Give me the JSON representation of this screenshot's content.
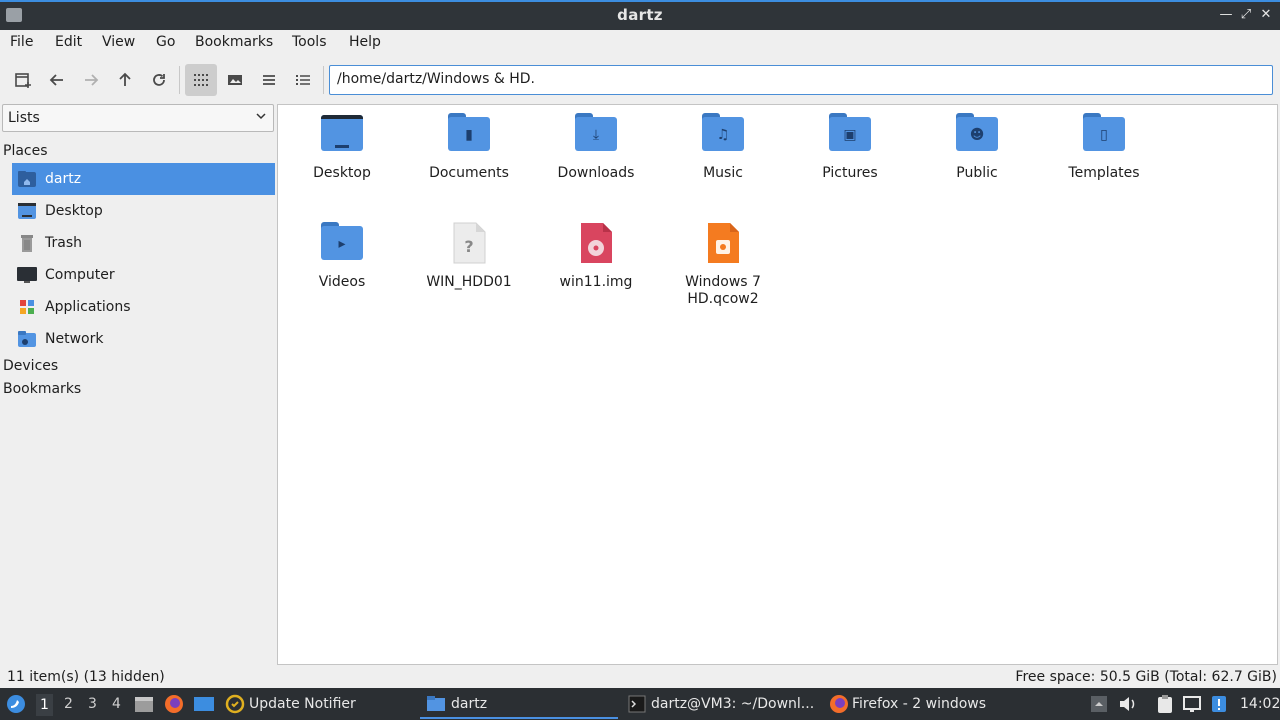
{
  "window": {
    "title": "dartz"
  },
  "menu": [
    "File",
    "Edit",
    "View",
    "Go",
    "Bookmarks",
    "Tools",
    "Help"
  ],
  "path": "/home/dartz/Windows & HD.",
  "side": {
    "select": "Lists",
    "places_heading": "Places",
    "items": [
      {
        "label": "dartz",
        "icon": "home-folder-icon"
      },
      {
        "label": "Desktop",
        "icon": "desktop-icon"
      },
      {
        "label": "Trash",
        "icon": "trash-icon"
      },
      {
        "label": "Computer",
        "icon": "computer-icon"
      },
      {
        "label": "Applications",
        "icon": "applications-icon"
      },
      {
        "label": "Network",
        "icon": "network-icon"
      }
    ],
    "devices_heading": "Devices",
    "bookmarks_heading": "Bookmarks"
  },
  "files": [
    {
      "name": "Desktop",
      "icon": "desktop-folder-icon"
    },
    {
      "name": "Documents",
      "icon": "documents-folder-icon"
    },
    {
      "name": "Downloads",
      "icon": "downloads-folder-icon"
    },
    {
      "name": "Music",
      "icon": "music-folder-icon"
    },
    {
      "name": "Pictures",
      "icon": "pictures-folder-icon"
    },
    {
      "name": "Public",
      "icon": "public-folder-icon"
    },
    {
      "name": "Templates",
      "icon": "templates-folder-icon"
    },
    {
      "name": "Videos",
      "icon": "videos-folder-icon"
    },
    {
      "name": "WIN_HDD01",
      "icon": "unknown-file-icon"
    },
    {
      "name": "win11.img",
      "icon": "disk-image-icon"
    },
    {
      "name": "Windows 7 HD.qcow2",
      "icon": "presentation-file-icon"
    }
  ],
  "status": {
    "items": "11 item(s) (13 hidden)",
    "free_space": "Free space: 50.5 GiB (Total: 62.7 GiB)"
  },
  "taskbar": {
    "workspaces": [
      "1",
      "2",
      "3",
      "4"
    ],
    "tasks": [
      "Update Notifier",
      "dartz",
      "dartz@VM3: ~/Downl...",
      "Firefox - 2 windows"
    ],
    "clock": "14:02"
  },
  "colors": {
    "accent": "#4a90e2",
    "folder": "#5294e2",
    "taskbar": "#2b2f33"
  }
}
